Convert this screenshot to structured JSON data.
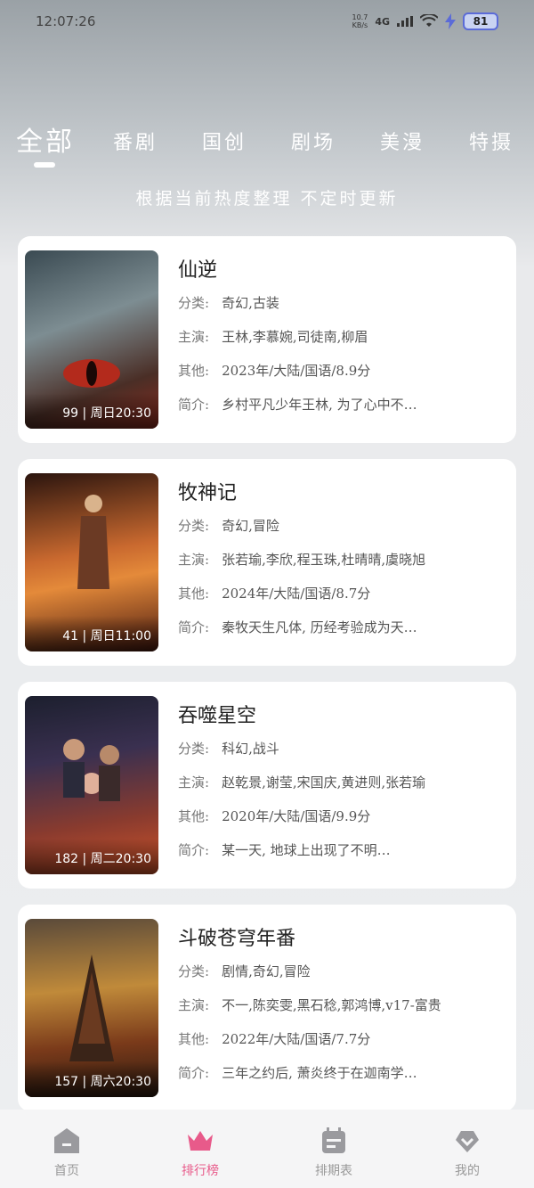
{
  "status": {
    "time": "12:07:26",
    "speed_value": "10.7",
    "speed_unit": "KB/s",
    "network": "4G",
    "battery": "81"
  },
  "tabs": [
    {
      "label": "全部"
    },
    {
      "label": "番剧"
    },
    {
      "label": "国创"
    },
    {
      "label": "剧场"
    },
    {
      "label": "美漫"
    },
    {
      "label": "特摄"
    }
  ],
  "subtitle": "根据当前热度整理 不定时更新",
  "labels": {
    "category": "分类:",
    "cast": "主演:",
    "other": "其他:",
    "intro": "简介:"
  },
  "items": [
    {
      "title": "仙逆",
      "ep": "99 | 周日20:30",
      "category": "奇幻,古装",
      "cast": "王林,李慕婉,司徒南,柳眉",
      "other": "2023年/大陆/国语/8.9分",
      "intro": "乡村平凡少年王林, 为了心中不…",
      "colors": [
        "#2b3c45",
        "#6d7f86",
        "#9a3a2a"
      ]
    },
    {
      "title": "牧神记",
      "ep": "41 | 周日11:00",
      "category": "奇幻,冒险",
      "cast": "张若瑜,李欣,程玉珠,杜晴晴,虞晓旭",
      "other": "2024年/大陆/国语/8.7分",
      "intro": "秦牧天生凡体, 历经考验成为天…",
      "colors": [
        "#3a1a12",
        "#c2652e",
        "#6b2a17"
      ]
    },
    {
      "title": "吞噬星空",
      "ep": "182 | 周二20:30",
      "category": "科幻,战斗",
      "cast": "赵乾景,谢莹,宋国庆,黄进则,张若瑜",
      "other": "2020年/大陆/国语/9.9分",
      "intro": "某一天, 地球上出现了不明…",
      "colors": [
        "#1d2030",
        "#8a3b2e",
        "#d0542a"
      ]
    },
    {
      "title": "斗破苍穹年番",
      "ep": "157 | 周六20:30",
      "category": "剧情,奇幻,冒险",
      "cast": "不一,陈奕雯,黑石稔,郭鸿博,v17-富贵",
      "other": "2022年/大陆/国语/7.7分",
      "intro": "三年之约后, 萧炎终于在迦南学…",
      "colors": [
        "#3a2a1a",
        "#c08a3a",
        "#7a3a1a"
      ]
    }
  ],
  "nav": [
    {
      "label": "首页",
      "icon": "home-icon"
    },
    {
      "label": "排行榜",
      "icon": "crown-icon"
    },
    {
      "label": "排期表",
      "icon": "calendar-icon"
    },
    {
      "label": "我的",
      "icon": "heart-icon"
    }
  ],
  "accent": "#e85a8a"
}
